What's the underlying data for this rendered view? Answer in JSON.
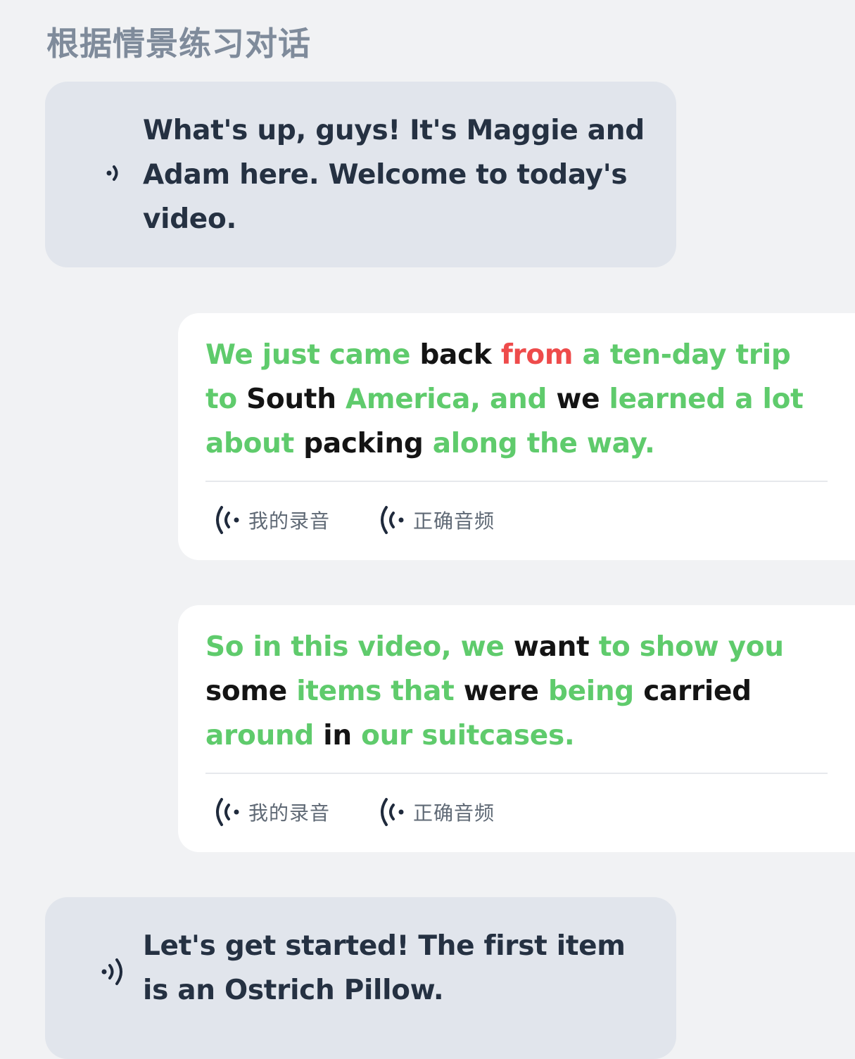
{
  "page": {
    "title": "根据情景练习对话"
  },
  "messages": [
    {
      "role": "prompt",
      "text": "What's up, guys! It's Maggie and Adam here. Welcome to today's video.",
      "play_icon": "speaker-small-icon"
    },
    {
      "role": "reply",
      "words": [
        {
          "t": "We just came ",
          "s": "green"
        },
        {
          "t": "back ",
          "s": "black"
        },
        {
          "t": "from ",
          "s": "red"
        },
        {
          "t": "a ten-day trip to ",
          "s": "green"
        },
        {
          "t": "South ",
          "s": "black"
        },
        {
          "t": "America, and ",
          "s": "green"
        },
        {
          "t": "we ",
          "s": "black"
        },
        {
          "t": "learned a lot about ",
          "s": "green"
        },
        {
          "t": "packing ",
          "s": "black"
        },
        {
          "t": "along the way.",
          "s": "green"
        }
      ],
      "my_recording": "我的录音",
      "correct_audio": "正确音频"
    },
    {
      "role": "reply",
      "words": [
        {
          "t": "So in this video, we ",
          "s": "green"
        },
        {
          "t": "want ",
          "s": "black"
        },
        {
          "t": "to show you ",
          "s": "green"
        },
        {
          "t": "some ",
          "s": "black"
        },
        {
          "t": "items that ",
          "s": "green"
        },
        {
          "t": "were ",
          "s": "black"
        },
        {
          "t": "being ",
          "s": "green"
        },
        {
          "t": "carried ",
          "s": "black"
        },
        {
          "t": "around ",
          "s": "green"
        },
        {
          "t": "in ",
          "s": "black"
        },
        {
          "t": "our suitcases.",
          "s": "green"
        }
      ],
      "my_recording": "我的录音",
      "correct_audio": "正确音频"
    },
    {
      "role": "prompt",
      "text": "Let's get started! The first item is an Ostrich Pillow.",
      "play_icon": "speaker-medium-icon"
    }
  ],
  "colors": {
    "correct": "#5fcb6c",
    "wrong": "#ee4b4b",
    "neutral": "#141414",
    "prompt_bubble": "#e1e5ec",
    "reply_bubble": "#ffffff",
    "background": "#f1f2f4"
  }
}
